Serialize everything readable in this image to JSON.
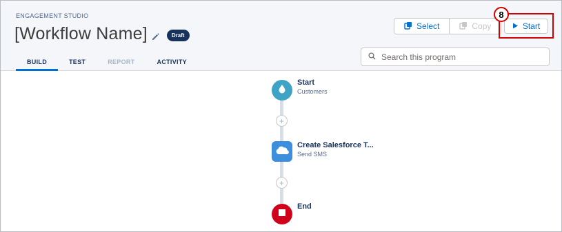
{
  "header": {
    "eyebrow": "ENGAGEMENT STUDIO",
    "title": "[Workflow Name]",
    "status_badge": "Draft",
    "edit_icon": "pencil-icon"
  },
  "tabs": [
    {
      "label": "BUILD",
      "state": "active"
    },
    {
      "label": "TEST",
      "state": "normal"
    },
    {
      "label": "REPORT",
      "state": "disabled"
    },
    {
      "label": "ACTIVITY",
      "state": "normal"
    }
  ],
  "toolbar": {
    "select_label": "Select",
    "copy_label": "Copy",
    "start_label": "Start",
    "callout_number": "8"
  },
  "search": {
    "placeholder": "Search this program",
    "value": ""
  },
  "flow": {
    "nodes": [
      {
        "title": "Start",
        "subtitle": "Customers",
        "icon": "drop-icon",
        "kind": "start"
      },
      {
        "title": "Create Salesforce T...",
        "subtitle": "Send SMS",
        "icon": "cloud-icon",
        "kind": "action"
      },
      {
        "title": "End",
        "subtitle": "",
        "icon": "stop-icon",
        "kind": "end"
      }
    ],
    "add_step_symbol": "+"
  },
  "colors": {
    "accent": "#0070d2",
    "badge": "#16325c",
    "callout_border": "#d40000",
    "start_node": "#3ea3c4",
    "action_node": "#3e8ede",
    "end_node": "#d0021b"
  }
}
